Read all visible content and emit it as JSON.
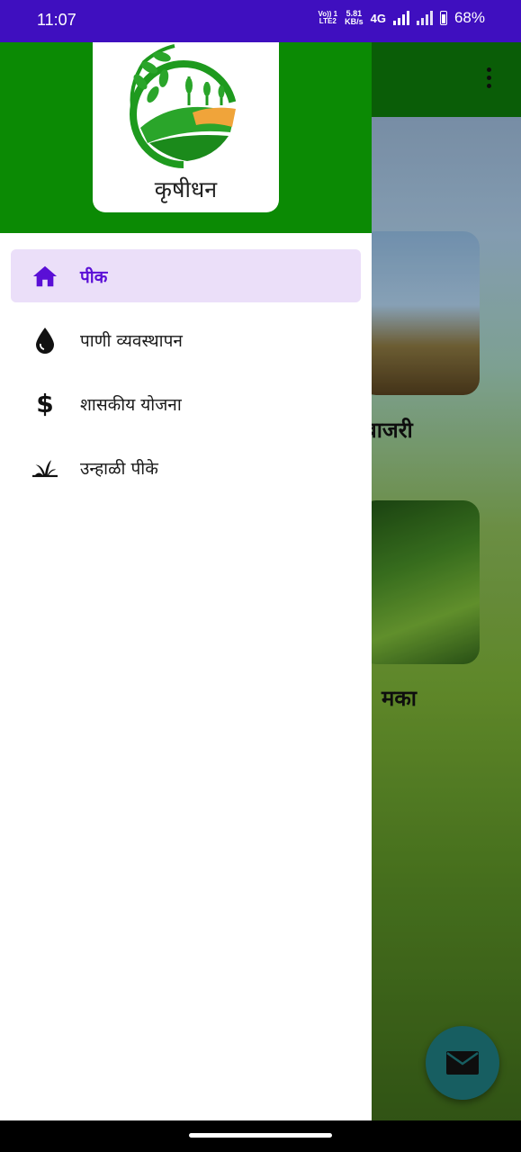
{
  "status_bar": {
    "time": "11:07",
    "volte_top": "Vo)) 1",
    "volte_bottom": "LTE2",
    "speed_value": "5.81",
    "speed_unit": "KB/s",
    "network": "4G",
    "battery": "68%"
  },
  "drawer": {
    "app_name": "कृषीधन",
    "items": [
      {
        "label": "पीक",
        "icon": "home-icon",
        "active": true
      },
      {
        "label": "पाणी व्यवस्थापन",
        "icon": "water-drop-icon",
        "active": false
      },
      {
        "label": "शासकीय योजना",
        "icon": "dollar-icon",
        "active": false
      },
      {
        "label": "उन्हाळी पीके",
        "icon": "grass-icon",
        "active": false
      }
    ]
  },
  "background_app": {
    "crops": [
      {
        "label": "बाजरी"
      },
      {
        "label": "मका"
      }
    ]
  },
  "colors": {
    "status_bar": "#3f0fbf",
    "drawer_header": "#0b8a04",
    "active_item_bg": "#ebdff9",
    "active_item_text": "#5a0fd6",
    "fab": "#1b6c6f"
  }
}
